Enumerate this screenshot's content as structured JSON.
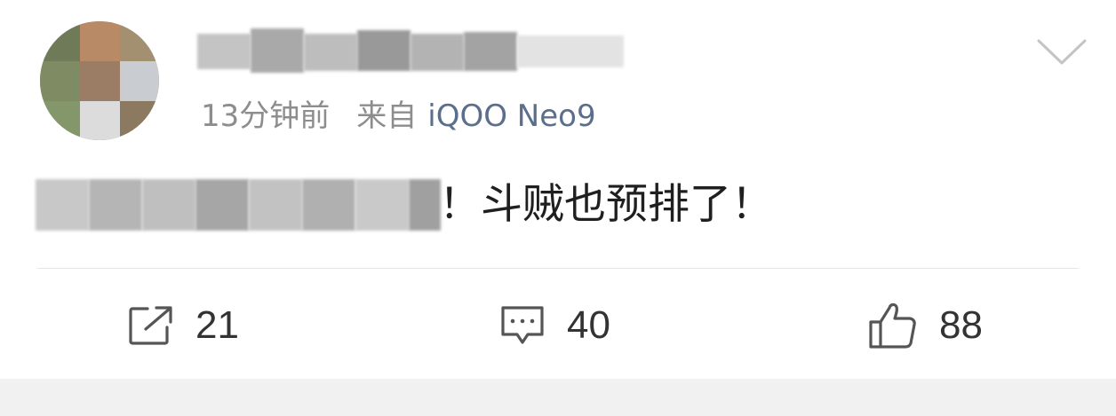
{
  "post": {
    "time_ago": "13分钟前",
    "source_prefix": "来自",
    "device": "iQOO Neo9",
    "body_visible": "！斗贼也预排了！"
  },
  "actions": {
    "share_count": "21",
    "comment_count": "40",
    "like_count": "88"
  },
  "colors": {
    "meta_gray": "#8d8d8d",
    "device_blue": "#5b6e8c",
    "body_text": "#1f1f1f",
    "icon_gray": "#555555",
    "divider": "#e6e6e6",
    "bottom_band": "#f1f1f1"
  },
  "icons": {
    "more": "chevron-down-icon",
    "share": "share-icon",
    "comment": "comment-icon",
    "like": "thumbs-up-icon"
  }
}
